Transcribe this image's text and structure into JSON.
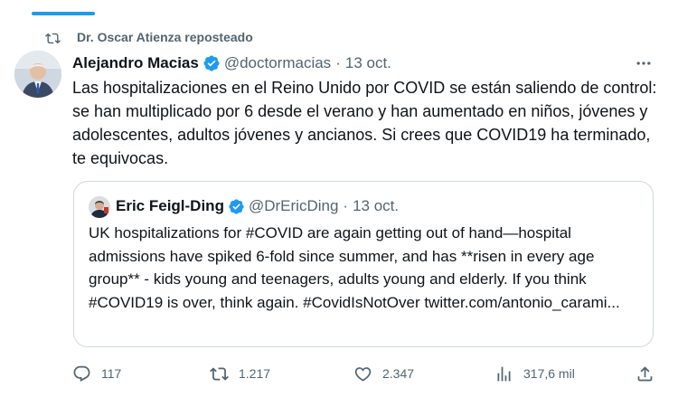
{
  "colors": {
    "accent": "#1d9bf0",
    "muted": "#536471",
    "text": "#0f1419",
    "border": "#cfd9de"
  },
  "repost": {
    "icon": "repost-icon",
    "label": "Dr. Oscar Atienza reposteado"
  },
  "tweet": {
    "author_name": "Alejandro Macias",
    "handle": "@doctormacias",
    "separator": "·",
    "date": "13 oct.",
    "text": "Las hospitalizaciones en el Reino Unido por COVID se están saliendo de control: se han multiplicado por 6 desde el verano y han aumentado en niños, jóvenes y adolescentes, adultos jóvenes y ancianos. Si crees que COVID19 ha terminado, te equivocas."
  },
  "quoted": {
    "author_name": "Eric Feigl-Ding",
    "handle": "@DrEricDing",
    "separator": "·",
    "date": "13 oct.",
    "text": "UK hospitalizations for #COVID are again getting out of hand—hospital admissions have spiked 6-fold since summer, and has **risen in every age group** - kids young and teenagers, adults young and elderly. If you think #COVID19 is over, think again. #CovidIsNotOver twitter.com/antonio_carami..."
  },
  "actions": {
    "replies": "117",
    "reposts": "1.217",
    "likes": "2.347",
    "views": "317,6 mil"
  }
}
